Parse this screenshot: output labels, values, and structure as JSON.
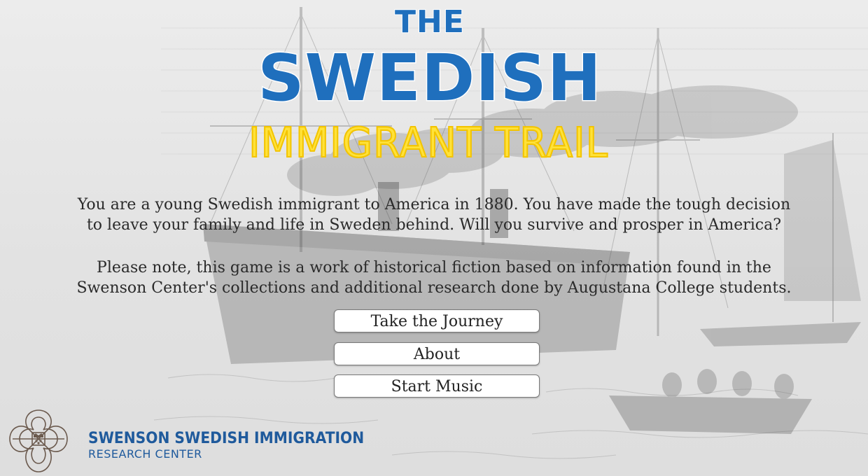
{
  "title": {
    "line1": "THE",
    "line2": "SWEDISH",
    "line3": "IMMIGRANT TRAIL"
  },
  "intro": {
    "line1": "You are a young Swedish immigrant to America in 1880. You have made the tough decision",
    "line2": "to leave your family and life in Sweden behind. Will you survive and prosper in America?"
  },
  "note": {
    "line1": "Please note, this game is a work of historical fiction based on information found in the",
    "line2": "Swenson Center's collections and additional research done by Augustana College students."
  },
  "buttons": {
    "journey": "Take the Journey",
    "about": "About",
    "music": "Start Music"
  },
  "logo": {
    "line1": "SWENSON SWEDISH IMMIGRATION",
    "line2": "RESEARCH CENTER"
  },
  "colors": {
    "title_blue": "#1f6fbd",
    "title_yellow": "#ffe23a",
    "logo_blue": "#1f5a9c",
    "background": "#e4e4e4"
  },
  "icons": {
    "background": "steamship-engraving-illustration",
    "logo": "swenson-center-crest-icon"
  }
}
